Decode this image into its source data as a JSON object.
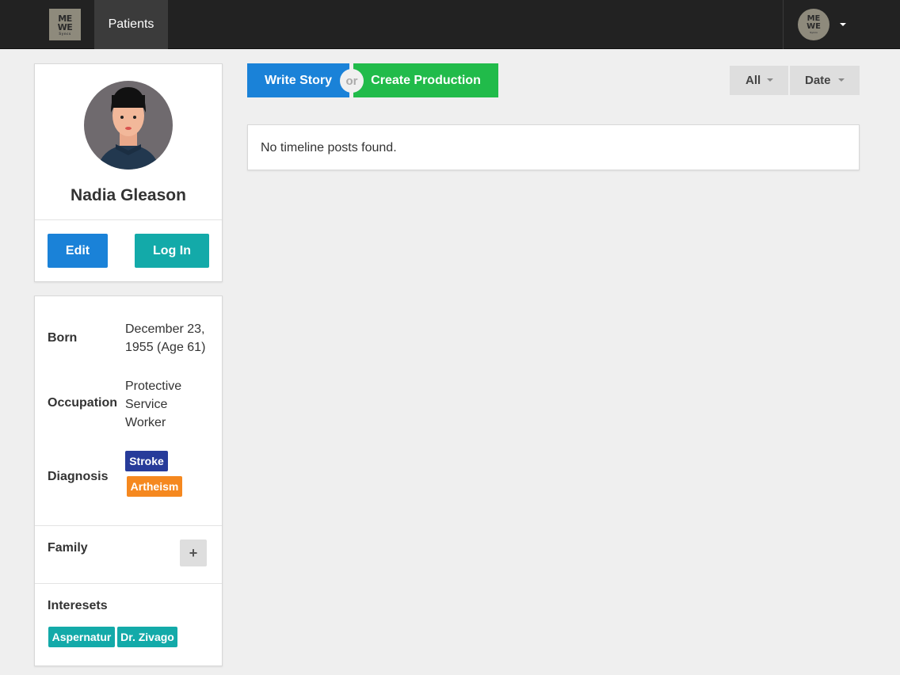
{
  "navbar": {
    "logo": {
      "line1": "ME",
      "line2": "WE",
      "sub": "Syncs"
    },
    "nav_item": "Patients",
    "user_avatar": {
      "line1": "ME",
      "line2": "WE",
      "sub": "Syncs"
    }
  },
  "profile": {
    "name": "Nadia Gleason",
    "edit_label": "Edit",
    "login_label": "Log In",
    "colors": {
      "edit": "#1a82d8",
      "login": "#13aaa9"
    }
  },
  "info": {
    "born_label": "Born",
    "born_line1": "December 23,",
    "born_line2": "1955 (Age 61)",
    "occupation_label": "Occupation",
    "occupation_line1": "Protective",
    "occupation_line2": "Service",
    "occupation_line3": "Worker",
    "diagnosis_label": "Diagnosis",
    "diagnoses": [
      {
        "label": "Stroke",
        "color": "#273b9a"
      },
      {
        "label": "Artheism",
        "color": "#f5881f"
      }
    ],
    "family_label": "Family",
    "family_add": "+",
    "interests_label": "Interesets",
    "interests": [
      {
        "label": "Aspernatur",
        "color": "#13aaa9"
      },
      {
        "label": "Dr. Zivago",
        "color": "#13aaa9"
      }
    ]
  },
  "actions": {
    "write_story": "Write Story",
    "or": "or",
    "create_production": "Create Production",
    "colors": {
      "write": "#1a82d8",
      "create": "#21bb4a"
    }
  },
  "filters": {
    "all": "All",
    "date": "Date"
  },
  "timeline": {
    "empty_message": "No timeline posts found."
  }
}
